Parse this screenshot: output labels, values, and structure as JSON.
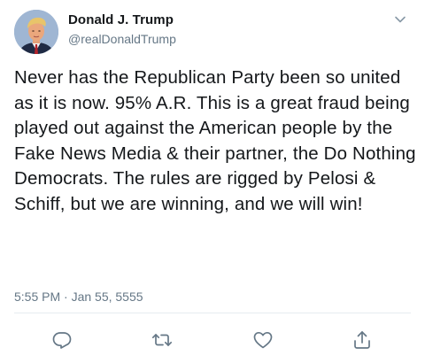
{
  "tweet": {
    "author": {
      "display_name": "Donald J. Trump",
      "handle": "@realDonaldTrump",
      "avatar_icon": "profile-photo"
    },
    "text": "Never has the Republican Party been so united as it is now. 95% A.R. This is a great fraud being played out against the American people by the Fake News Media & their partner, the Do Nothing Democrats. The rules are rigged by Pelosi & Schiff, but we are winning, and we will win!",
    "timestamp": "5:55 PM · Jan 55, 5555"
  },
  "actions": {
    "reply_icon": "reply-icon",
    "retweet_icon": "retweet-icon",
    "like_icon": "heart-icon",
    "share_icon": "share-icon"
  },
  "colors": {
    "primary_text": "#14171a",
    "secondary_text": "#657786",
    "divider": "#e6ecf0"
  }
}
